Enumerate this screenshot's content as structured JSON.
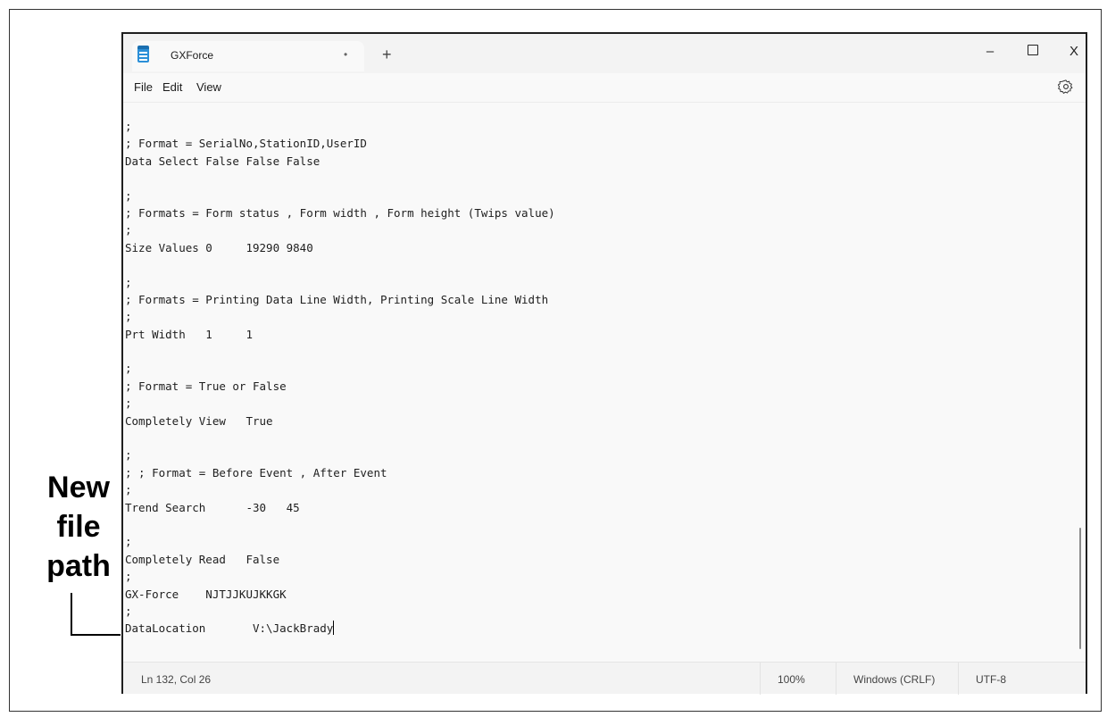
{
  "annotation": {
    "callout_lines": [
      "New",
      "file",
      "path"
    ]
  },
  "window": {
    "tab_title": "GXForce",
    "tab_modified_glyph": "•",
    "new_tab_glyph": "+",
    "minimize_glyph": "–",
    "close_glyph": "X"
  },
  "menu": {
    "file": "File",
    "edit": "Edit",
    "view": "View"
  },
  "editor": {
    "lines": [
      ";",
      "; Format = SerialNo,StationID,UserID",
      "Data Select False False False",
      "",
      ";",
      "; Formats = Form status , Form width , Form height (Twips value)",
      ";",
      "Size Values 0     19290 9840",
      "",
      ";",
      "; Formats = Printing Data Line Width, Printing Scale Line Width",
      ";",
      "Prt Width   1     1",
      "",
      ";",
      "; Format = True or False",
      ";",
      "Completely View   True",
      "",
      ";",
      "; ; Format = Before Event , After Event",
      ";",
      "Trend Search      -30   45",
      "",
      ";",
      "Completely Read   False",
      ";",
      "GX-Force    NJTJJKUJKKGK",
      ";",
      "DataLocation       V:\\JackBrady"
    ]
  },
  "status": {
    "position": "Ln 132, Col 26",
    "zoom": "100%",
    "line_ending": "Windows (CRLF)",
    "encoding": "UTF-8"
  },
  "icons": {
    "app": "notepad-icon",
    "settings": "gear-icon"
  }
}
